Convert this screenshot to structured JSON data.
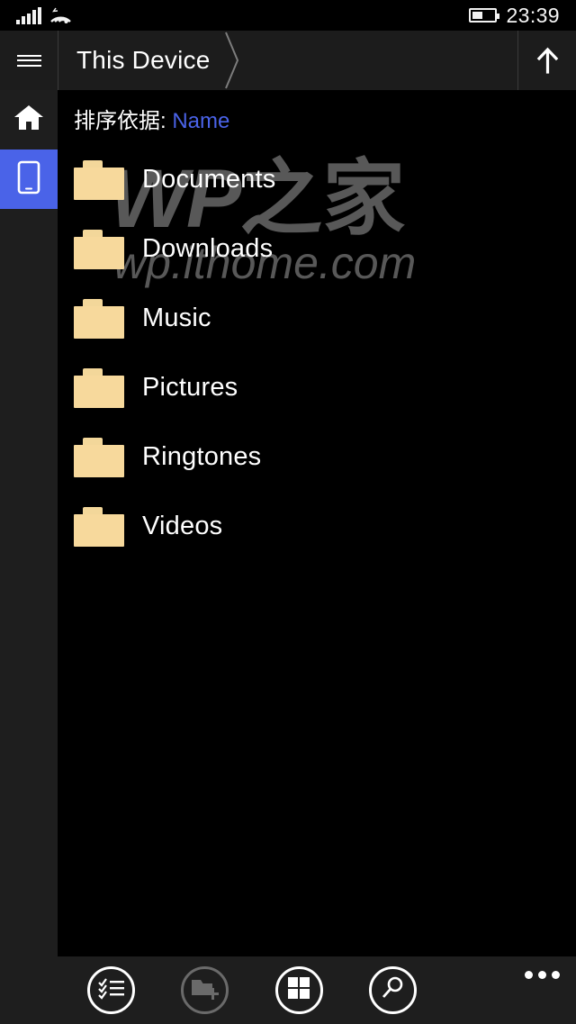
{
  "status_bar": {
    "signal_icon": "cellular-signal-icon",
    "signal_bars": 5,
    "wifi_icon": "wifi-icon",
    "battery_icon": "battery-icon",
    "battery_level_percent": 40,
    "time": "23:39"
  },
  "header": {
    "menu_icon": "hamburger-menu-icon",
    "breadcrumb": "This Device",
    "separator_icon": "chevron-right-icon",
    "up_icon": "arrow-up-icon"
  },
  "rail": {
    "items": [
      {
        "label": "Home",
        "icon": "home-icon",
        "selected": false
      },
      {
        "label": "This Device",
        "icon": "phone-icon",
        "selected": true
      }
    ],
    "accent_color": "#4a63e8"
  },
  "content": {
    "sort": {
      "label": "排序依据:",
      "value": "Name"
    },
    "folders": [
      {
        "name": "Documents",
        "icon": "folder-icon"
      },
      {
        "name": "Downloads",
        "icon": "folder-icon"
      },
      {
        "name": "Music",
        "icon": "folder-icon"
      },
      {
        "name": "Pictures",
        "icon": "folder-icon"
      },
      {
        "name": "Ringtones",
        "icon": "folder-icon"
      },
      {
        "name": "Videos",
        "icon": "folder-icon"
      }
    ],
    "folder_color": "#f7d99c"
  },
  "watermark": {
    "line1_latin": "WP",
    "line1_cjk": "之家",
    "line2": "wp.ithome.com",
    "color": "#585858"
  },
  "app_bar": {
    "buttons": [
      {
        "label": "Select",
        "icon": "checklist-icon",
        "enabled": true
      },
      {
        "label": "New folder",
        "icon": "new-folder-icon",
        "enabled": false
      },
      {
        "label": "View",
        "icon": "grid-view-icon",
        "enabled": true
      },
      {
        "label": "Search",
        "icon": "search-icon",
        "enabled": true
      }
    ],
    "overflow_icon": "ellipsis-icon"
  }
}
